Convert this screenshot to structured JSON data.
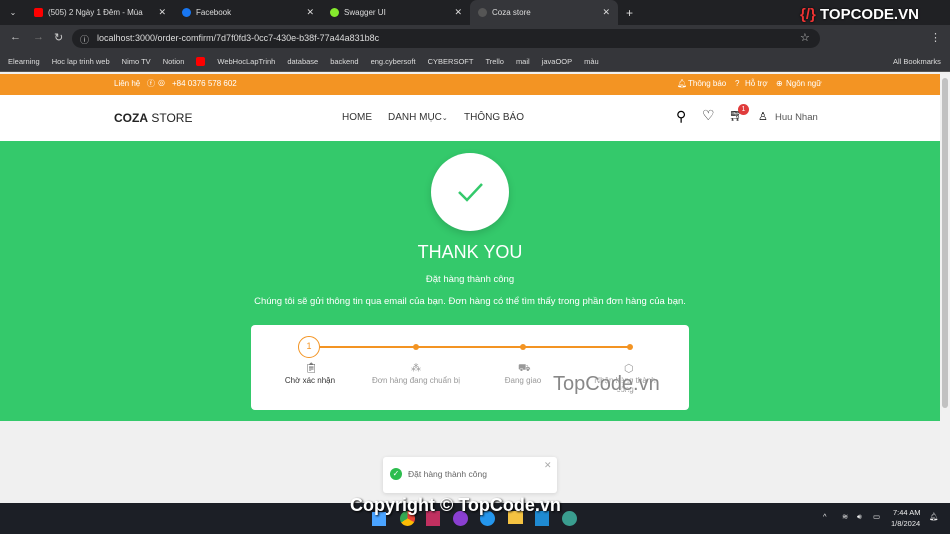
{
  "browser": {
    "tabs": [
      {
        "title": "(505) 2 Ngày 1 Đêm - Mùa",
        "color": "#ff0000"
      },
      {
        "title": "Facebook",
        "color": "#1877f2"
      },
      {
        "title": "Swagger UI",
        "color": "#85ea2d"
      },
      {
        "title": "Coza store",
        "color": "#555555"
      }
    ],
    "url": "localhost:3000/order-comfirm/7d7f0fd3-0cc7-430e-b38f-77a44a831b8c",
    "bookmarks": [
      "Elearning",
      "Hoc lap trinh web",
      "Nimo TV",
      "Notion",
      "",
      "WebHocLapTrinh",
      "database",
      "backend",
      "eng.cybersoft",
      "CYBERSOFT",
      "Trello",
      "mail",
      "javaOOP",
      "màu"
    ],
    "all_bookmarks": "All Bookmarks"
  },
  "topbar": {
    "contact": "Liên hệ",
    "phone": "+84 0376 578 602",
    "notify": "Thông báo",
    "help": "Hỗ trợ",
    "lang": "Ngôn ngữ"
  },
  "header": {
    "logo_bold": "COZA",
    "logo_rest": " STORE",
    "nav": [
      "HOME",
      "DANH MỤC",
      "THÔNG BÁO"
    ],
    "cart_count": "1",
    "user": "Huu Nhan"
  },
  "main": {
    "title": "THANK YOU",
    "subtitle": "Đặt hàng thành công",
    "message": "Chúng tôi sẽ gửi thông tin qua email của bạn. Đơn hàng có thể tìm thấy trong phần đơn hàng của bạn.",
    "current_step": 1,
    "steps": [
      {
        "label": "Chờ xác nhận",
        "number": "1",
        "icon": "clipboard-check-icon"
      },
      {
        "label": "Đơn hàng đang chuẩn bị",
        "icon": "boxes-icon"
      },
      {
        "label": "Đang giao",
        "icon": "truck-icon"
      },
      {
        "label": "Nhận hàng thành công",
        "icon": "package-icon"
      }
    ],
    "accent": "#f39423",
    "hero_color": "#34c96b"
  },
  "toast": {
    "text": "Đặt hàng thành công"
  },
  "taskbar": {
    "time": "7:44 AM",
    "date": "1/8/2024"
  },
  "watermarks": [
    "TOPCODE.VN",
    "TopCode.vn",
    "Copyright © TopCode.vn"
  ]
}
